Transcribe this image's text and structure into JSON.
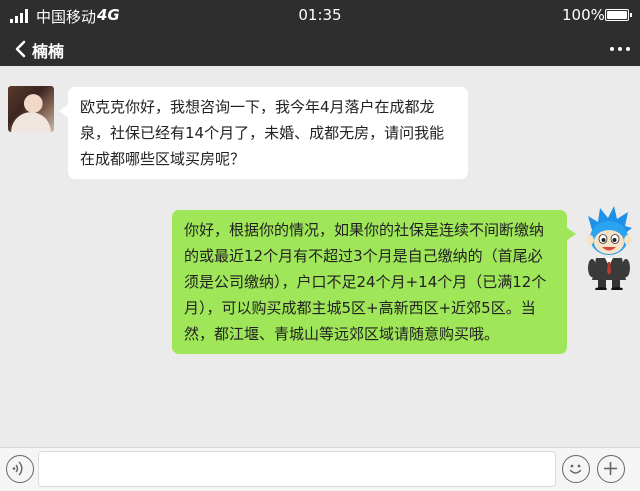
{
  "status_bar": {
    "carrier": "中国移动",
    "network": "4G",
    "time": "01:35",
    "battery": "100%"
  },
  "nav": {
    "title": "楠楠",
    "back_icon": "chevron-left-icon",
    "more_icon": "more-dots-icon"
  },
  "messages": [
    {
      "side": "left",
      "text": "欧克克你好，我想咨询一下，我今年4月落户在成都龙泉，社保已经有14个月了，未婚、成都无房，请问我能在成都哪些区域买房呢？"
    },
    {
      "side": "right",
      "text": "你好，根据你的情况，如果你的社保是连续不间断缴纳的或最近12个月有不超过3个月是自己缴纳的（首尾必须是公司缴纳），户口不足24个月+14个月（已满12个月），可以购买成都主城5区+高新西区+近郊5区。当然，都江堰、青城山等远郊区域请随意购买哦。"
    }
  ],
  "input_bar": {
    "voice_icon": "voice-icon",
    "emoji_icon": "emoji-icon",
    "plus_icon": "plus-icon",
    "message_value": ""
  },
  "colors": {
    "header": "#2e2e2e",
    "chat_bg": "#ebebeb",
    "bubble_sent": "#9fe658",
    "bubble_received": "#ffffff"
  }
}
